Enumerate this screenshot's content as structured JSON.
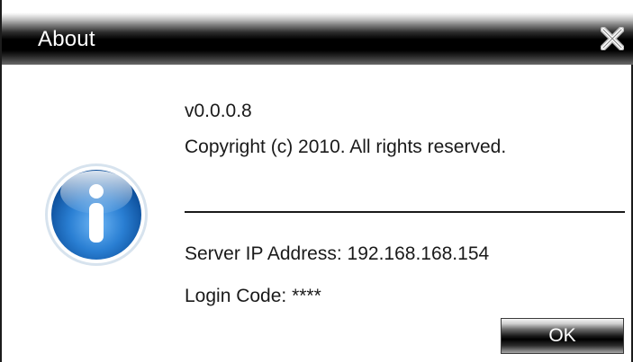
{
  "window": {
    "title": "About",
    "close_icon": "close-x-icon"
  },
  "icon": {
    "name": "info-icon",
    "glyph": "i",
    "color": "#2a7fd3"
  },
  "about": {
    "version": "v0.0.0.8",
    "copyright": "Copyright (c) 2010. All rights reserved.",
    "server_ip": "Server IP Address: 192.168.168.154",
    "login_code": "Login Code: ****"
  },
  "buttons": {
    "ok_label": "OK"
  }
}
